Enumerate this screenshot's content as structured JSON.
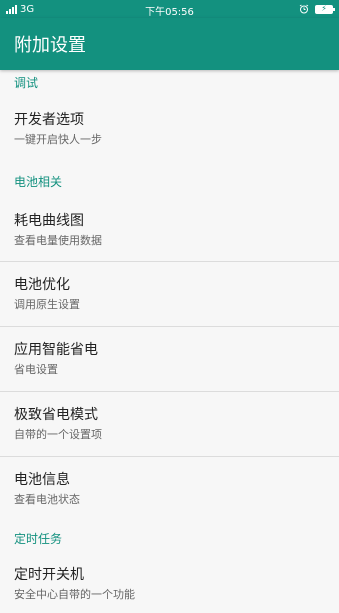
{
  "status_bar": {
    "network": "3G",
    "time": "下午05:56",
    "icons": [
      "signal-icon",
      "alarm-icon",
      "battery-charging-icon"
    ]
  },
  "app_bar": {
    "title": "附加设置"
  },
  "sections": {
    "debug": {
      "header": "调试",
      "items": [
        {
          "title": "开发者选项",
          "subtitle": "一键开启快人一步"
        }
      ]
    },
    "battery": {
      "header": "电池相关",
      "items": [
        {
          "title": "耗电曲线图",
          "subtitle": "查看电量使用数据"
        },
        {
          "title": "电池优化",
          "subtitle": "调用原生设置"
        },
        {
          "title": "应用智能省电",
          "subtitle": "省电设置"
        },
        {
          "title": "极致省电模式",
          "subtitle": "自带的一个设置项"
        },
        {
          "title": "电池信息",
          "subtitle": "查看电池状态"
        }
      ]
    },
    "timer": {
      "header": "定时任务",
      "items": [
        {
          "title": "定时开关机",
          "subtitle": "安全中心自带的一个功能"
        }
      ]
    }
  },
  "colors": {
    "primary": "#13917f",
    "background": "#f7f7f7"
  }
}
